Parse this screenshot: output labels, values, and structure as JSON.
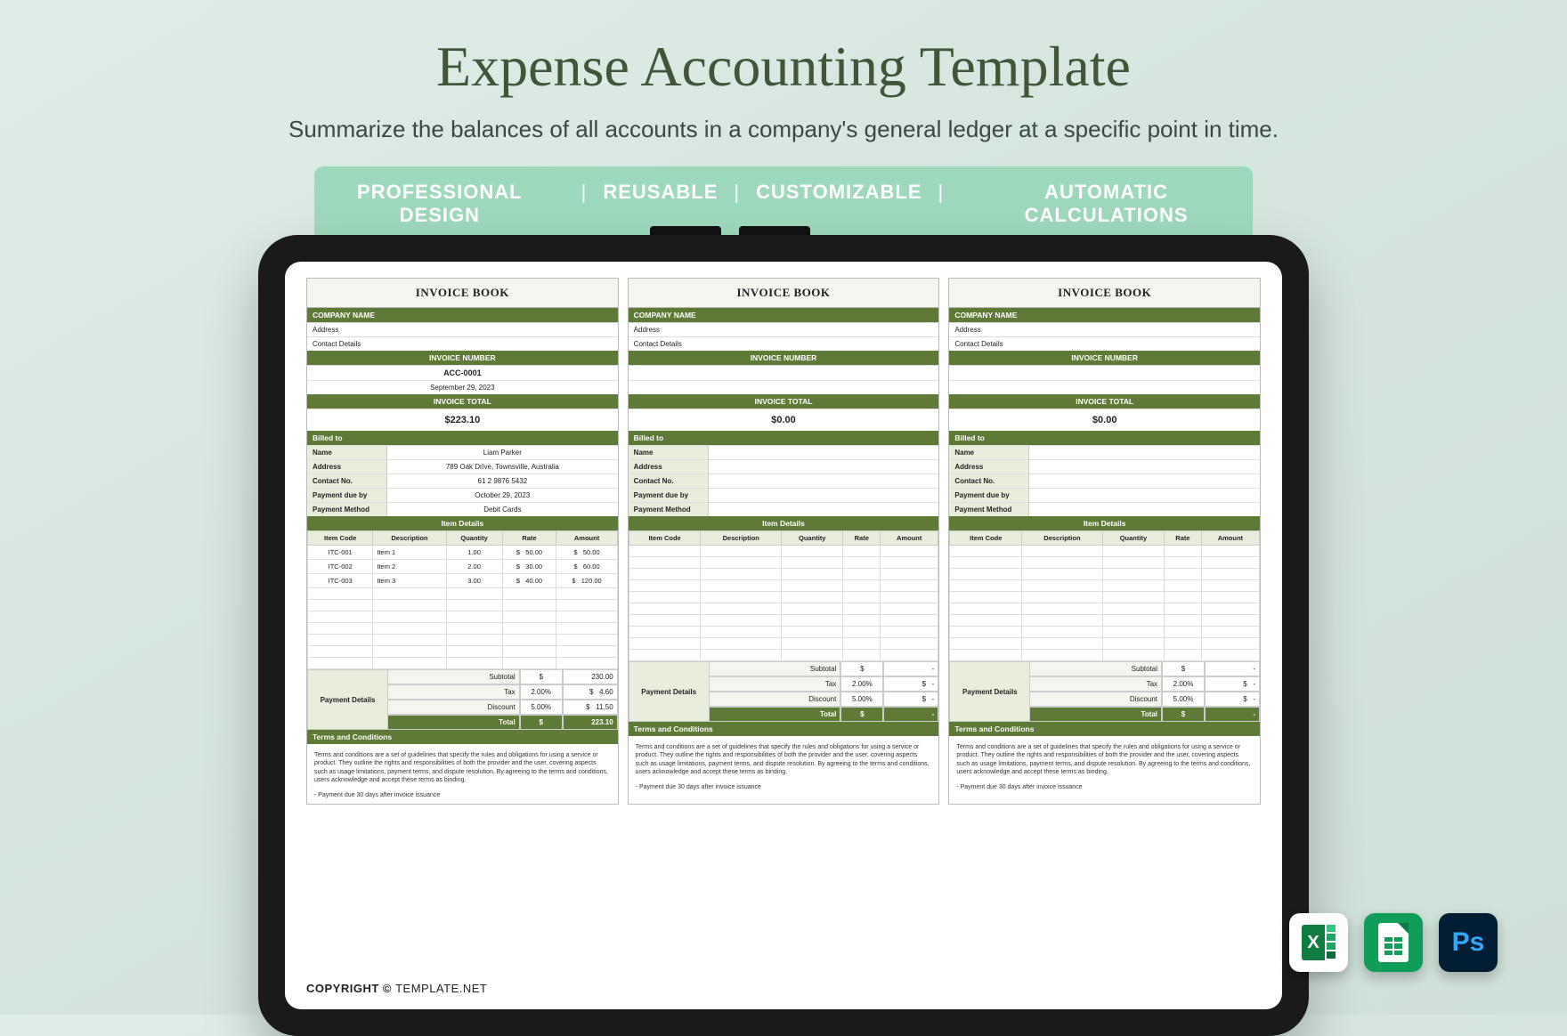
{
  "hero": {
    "title": "Expense Accounting Template",
    "subtitle": "Summarize the balances of all accounts in a company's general ledger at a specific point in time."
  },
  "features": [
    "PROFESSIONAL DESIGN",
    "REUSABLE",
    "CUSTOMIZABLE",
    "AUTOMATIC CALCULATIONS"
  ],
  "labels": {
    "invoice_title": "INVOICE BOOK",
    "company_name": "COMPANY NAME",
    "address": "Address",
    "contact_details": "Contact Details",
    "invoice_number": "INVOICE NUMBER",
    "invoice_total": "INVOICE TOTAL",
    "billed_to": "Billed to",
    "name": "Name",
    "addr": "Address",
    "contact_no": "Contact No.",
    "payment_due": "Payment due by",
    "payment_method": "Payment Method",
    "item_details": "Item Details",
    "item_code": "Item Code",
    "description": "Description",
    "quantity": "Quantity",
    "rate": "Rate",
    "amount": "Amount",
    "payment_details": "Payment Details",
    "subtotal": "Subtotal",
    "tax": "Tax",
    "discount": "Discount",
    "total": "Total",
    "terms": "Terms and Conditions",
    "terms_body": "Terms and conditions are a set of guidelines that specify the rules and obligations for using a service or product. They outline the rights and responsibilities of both the provider and the user, covering aspects such as usage limitations, payment terms, and dispute resolution. By agreeing to the terms and conditions, users acknowledge and accept these terms as binding.",
    "terms_foot": "- Payment due 30 days after invoice issuance"
  },
  "invoices": [
    {
      "number": "ACC-0001",
      "date": "September 29, 2023",
      "total": "$223.10",
      "billed": {
        "name": "Liam Parker",
        "address": "789 Oak Drive, Townsville, Australia",
        "contact": "61 2 9876 5432",
        "due": "October 29, 2023",
        "method": "Debit Cards"
      },
      "items": [
        {
          "code": "ITC-001",
          "desc": "Item 1",
          "qty": "1.00",
          "rate": "50.00",
          "amount": "50.00"
        },
        {
          "code": "ITC-002",
          "desc": "Item 2",
          "qty": "2.00",
          "rate": "30.00",
          "amount": "60.00"
        },
        {
          "code": "ITC-003",
          "desc": "Item 3",
          "qty": "3.00",
          "rate": "40.00",
          "amount": "120.00"
        }
      ],
      "summary": {
        "subtotal": "230.00",
        "tax_pct": "2.00%",
        "tax": "4.60",
        "disc_pct": "5.00%",
        "disc": "11.50",
        "total": "223.10"
      }
    },
    {
      "number": "",
      "date": "",
      "total": "$0.00",
      "billed": {
        "name": "",
        "address": "",
        "contact": "",
        "due": "",
        "method": ""
      },
      "items": [],
      "summary": {
        "subtotal": "-",
        "tax_pct": "2.00%",
        "tax": "-",
        "disc_pct": "5.00%",
        "disc": "-",
        "total": "-"
      }
    },
    {
      "number": "",
      "date": "",
      "total": "$0.00",
      "billed": {
        "name": "",
        "address": "",
        "contact": "",
        "due": "",
        "method": ""
      },
      "items": [],
      "summary": {
        "subtotal": "-",
        "tax_pct": "2.00%",
        "tax": "-",
        "disc_pct": "5.00%",
        "disc": "-",
        "total": "-"
      }
    }
  ],
  "copyright": {
    "pre": "COPYRIGHT  ©  ",
    "site": "TEMPLATE.NET"
  },
  "apps": {
    "excel": "X",
    "sheets": "",
    "ps": "Ps"
  }
}
